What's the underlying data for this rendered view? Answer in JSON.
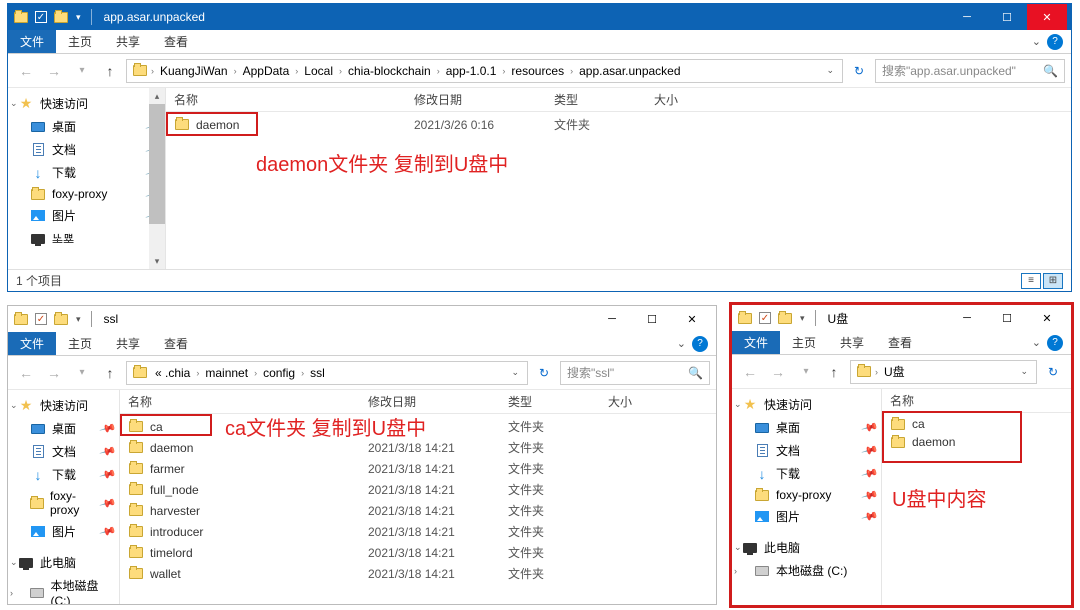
{
  "w1": {
    "title": "app.asar.unpacked",
    "tabs": {
      "file": "文件",
      "home": "主页",
      "share": "共享",
      "view": "查看"
    },
    "breadcrumb": [
      "KuangJiWan",
      "AppData",
      "Local",
      "chia-blockchain",
      "app-1.0.1",
      "resources",
      "app.asar.unpacked"
    ],
    "search_placeholder": "搜索\"app.asar.unpacked\"",
    "cols": {
      "name": "名称",
      "date": "修改日期",
      "type": "类型",
      "size": "大小"
    },
    "rows": [
      {
        "name": "daemon",
        "date": "2021/3/26 0:16",
        "type": "文件夹"
      }
    ],
    "status": "1 个项目",
    "annotation": "daemon文件夹 复制到U盘中",
    "sidebar": {
      "quick": "快速访问",
      "items": [
        "桌面",
        "文档",
        "下载",
        "foxy-proxy",
        "图片"
      ],
      "extra": "ᄔᆂᄜᆇ"
    }
  },
  "w2": {
    "title": "ssl",
    "tabs": {
      "file": "文件",
      "home": "主页",
      "share": "共享",
      "view": "查看"
    },
    "breadcrumb_prefix": "« .chia",
    "breadcrumb": [
      "mainnet",
      "config",
      "ssl"
    ],
    "search_placeholder": "搜索\"ssl\"",
    "cols": {
      "name": "名称",
      "date": "修改日期",
      "type": "类型",
      "size": "大小"
    },
    "rows": [
      {
        "name": "ca",
        "date": "",
        "type": "文件夹"
      },
      {
        "name": "daemon",
        "date": "2021/3/18 14:21",
        "type": "文件夹"
      },
      {
        "name": "farmer",
        "date": "2021/3/18 14:21",
        "type": "文件夹"
      },
      {
        "name": "full_node",
        "date": "2021/3/18 14:21",
        "type": "文件夹"
      },
      {
        "name": "harvester",
        "date": "2021/3/18 14:21",
        "type": "文件夹"
      },
      {
        "name": "introducer",
        "date": "2021/3/18 14:21",
        "type": "文件夹"
      },
      {
        "name": "timelord",
        "date": "2021/3/18 14:21",
        "type": "文件夹"
      },
      {
        "name": "wallet",
        "date": "2021/3/18 14:21",
        "type": "文件夹"
      }
    ],
    "annotation": "ca文件夹 复制到U盘中",
    "sidebar": {
      "quick": "快速访问",
      "items": [
        "桌面",
        "文档",
        "下载",
        "foxy-proxy",
        "图片"
      ],
      "thispc": "此电脑",
      "disk": "本地磁盘 (C:)"
    }
  },
  "w3": {
    "title": "U盘",
    "tabs": {
      "file": "文件",
      "home": "主页",
      "share": "共享",
      "view": "查看"
    },
    "breadcrumb": [
      "U盘"
    ],
    "cols": {
      "name": "名称"
    },
    "rows": [
      {
        "name": "ca"
      },
      {
        "name": "daemon"
      }
    ],
    "annotation": "U盘中内容",
    "sidebar": {
      "quick": "快速访问",
      "items": [
        "桌面",
        "文档",
        "下载",
        "foxy-proxy",
        "图片"
      ],
      "thispc": "此电脑",
      "disk": "本地磁盘 (C:)"
    }
  }
}
